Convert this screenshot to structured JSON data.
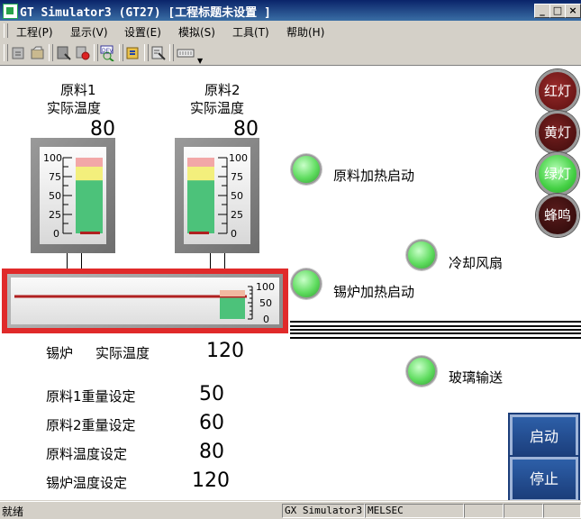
{
  "window": {
    "title": "GT Simulator3 (GT27) [工程标题未设置 ]"
  },
  "menu": [
    "工程(P)",
    "显示(V)",
    "设置(E)",
    "模拟(S)",
    "工具(T)",
    "帮助(H)"
  ],
  "toolbar": {
    "icons": [
      "open-project-icon",
      "reload-icon",
      "device-monitor-icon",
      "stop-icon",
      "search-icon",
      "settings-icon",
      "data-view-icon",
      "keyboard-icon"
    ]
  },
  "tanks": [
    {
      "name": "原料1",
      "label": "实际温度",
      "value": "80",
      "ticks": [
        "100",
        "75",
        "50",
        "25",
        "0"
      ],
      "level": 0.7
    },
    {
      "name": "原料2",
      "label": "实际温度",
      "value": "80",
      "ticks": [
        "100",
        "75",
        "50",
        "25",
        "0"
      ],
      "level": 0.7
    }
  ],
  "boiler_gauge": {
    "ticks": [
      "100",
      "50",
      "0"
    ],
    "level": 0.65
  },
  "boiler": {
    "name": "锡炉",
    "label": "实际温度",
    "value": "120"
  },
  "settings": [
    {
      "label": "原料1重量设定",
      "value": "50"
    },
    {
      "label": "原料2重量设定",
      "value": "60"
    },
    {
      "label": "原料温度设定",
      "value": "80"
    },
    {
      "label": "锡炉温度设定",
      "value": "120"
    }
  ],
  "indicators": {
    "raw_heat": "原料加热启动",
    "cool_fan": "冷却风扇",
    "boiler_heat": "锡炉加热启动",
    "glass_conveyor": "玻璃输送"
  },
  "lights": {
    "red": "红灯",
    "yellow": "黄灯",
    "green": "绿灯",
    "buzzer": "蜂鸣"
  },
  "buttons": {
    "start": "启动",
    "stop": "停止"
  },
  "status": {
    "ready": "就绪",
    "app": "GX Simulator3",
    "protocol": "MELSEC"
  },
  "colors": {
    "titlebar": "#0a246a",
    "lamp_green": "#5fdc5f",
    "red_light": "#8a1c1c",
    "yellow_light": "#5a1414",
    "buzzer": "#3a1010",
    "button_blue": "#1b3d7a",
    "alarm_border": "#e53030"
  }
}
